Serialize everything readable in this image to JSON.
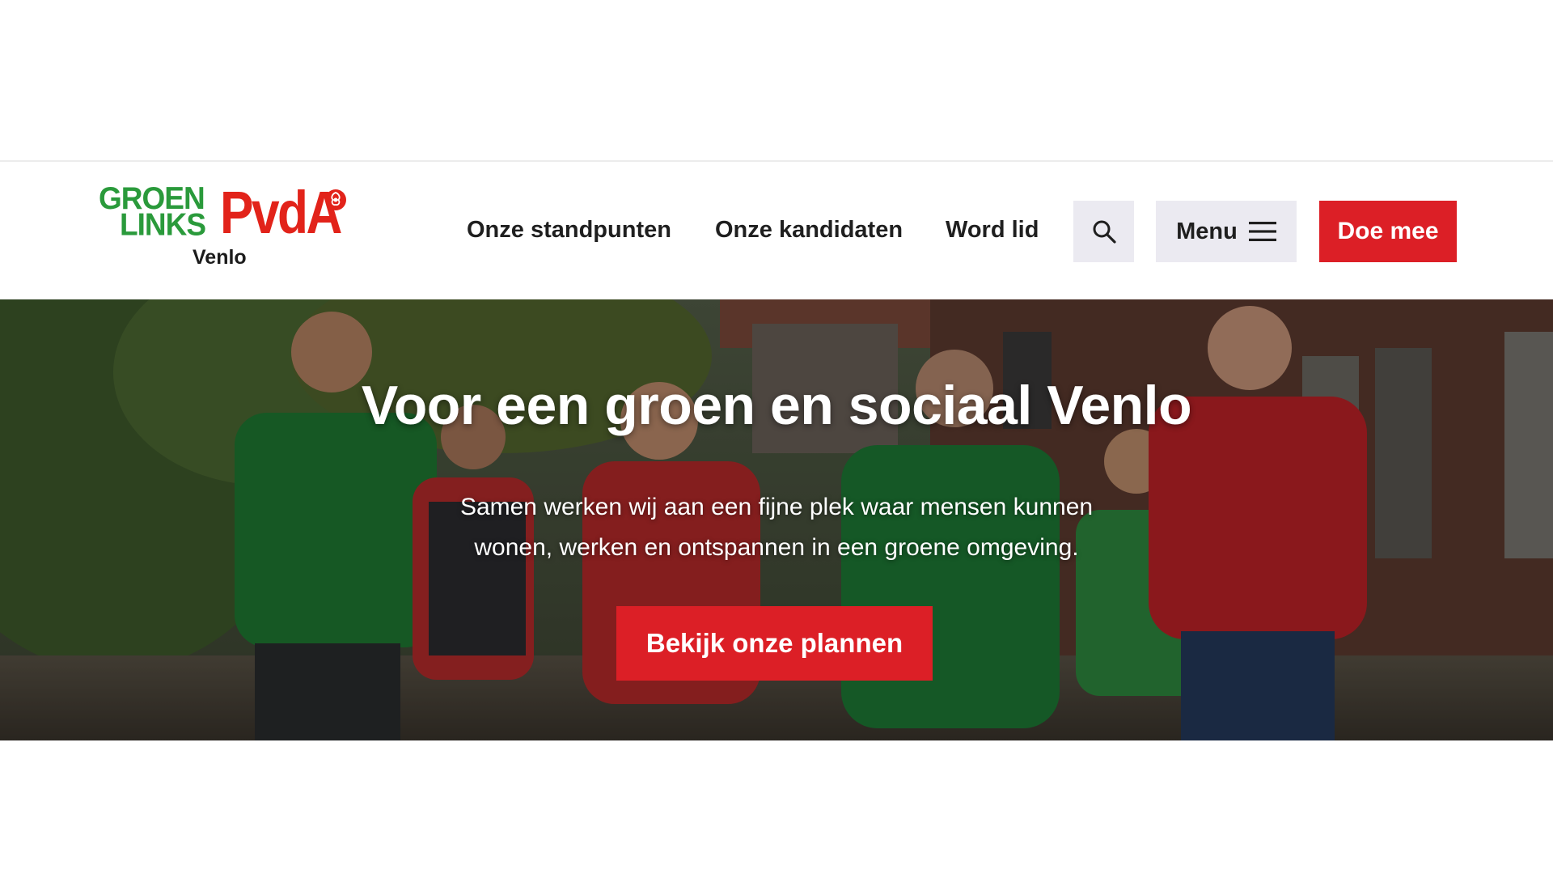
{
  "logo": {
    "groen": "GROEN",
    "links": "LINKS",
    "pvda": "PvdA",
    "city": "Venlo"
  },
  "nav": {
    "items": [
      {
        "label": "Onze standpunten"
      },
      {
        "label": "Onze kandidaten"
      },
      {
        "label": "Word lid"
      }
    ],
    "menu_label": "Menu",
    "cta_label": "Doe mee",
    "search_icon": "search-icon",
    "menu_icon": "hamburger-icon"
  },
  "hero": {
    "title": "Voor een groen en sociaal Venlo",
    "subtitle_line1": "Samen werken wij aan een fijne plek waar mensen kunnen",
    "subtitle_line2": "wonen, werken en ontspannen in een groene omgeving.",
    "cta_label": "Bekijk onze plannen"
  },
  "colors": {
    "brand_red": "#dc1f26",
    "brand_green": "#2a9a3b",
    "button_grey": "#ebeaf1",
    "text_dark": "#1f1f1f"
  }
}
